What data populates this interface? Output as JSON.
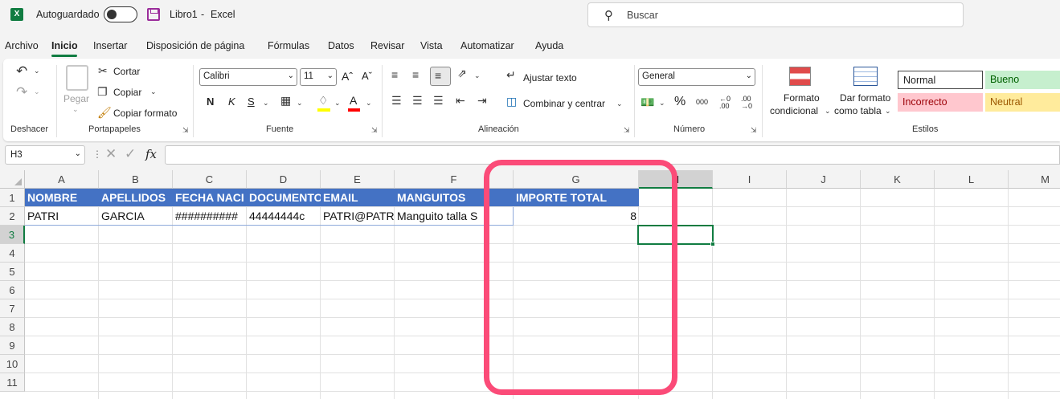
{
  "titlebar": {
    "autosave_label": "Autoguardado",
    "document_title": "Libro1",
    "title_separator": "-",
    "app_name": "Excel",
    "search_placeholder": "Buscar",
    "logo_letter": "X"
  },
  "menu": {
    "tabs": [
      "Archivo",
      "Inicio",
      "Insertar",
      "Disposición de página",
      "Fórmulas",
      "Datos",
      "Revisar",
      "Vista",
      "Automatizar",
      "Ayuda"
    ],
    "active_tab": "Inicio"
  },
  "ribbon": {
    "undo": {
      "group_label": "Deshacer"
    },
    "clipboard": {
      "group_label": "Portapapeles",
      "paste_label": "Pegar",
      "cut_label": "Cortar",
      "copy_label": "Copiar",
      "format_painter_label": "Copiar formato"
    },
    "font": {
      "group_label": "Fuente",
      "font_name": "Calibri",
      "font_size": "11",
      "bold": "N",
      "italic": "K",
      "underline": "S"
    },
    "alignment": {
      "group_label": "Alineación",
      "wrap_text": "Ajustar texto",
      "merge_center": "Combinar y centrar"
    },
    "number": {
      "group_label": "Número",
      "format": "General"
    },
    "styles": {
      "group_label": "Estilos",
      "conditional_format_line1": "Formato",
      "conditional_format_line2": "condicional",
      "format_table_line1": "Dar formato",
      "format_table_line2": "como tabla",
      "cells": [
        {
          "label": "Normal",
          "bg": "#ffffff",
          "fg": "#111111"
        },
        {
          "label": "Bueno",
          "bg": "#c6efce",
          "fg": "#006100"
        },
        {
          "label": "Incorrecto",
          "bg": "#ffc7ce",
          "fg": "#9c0006"
        },
        {
          "label": "Neutral",
          "bg": "#ffeb9c",
          "fg": "#9c5700"
        }
      ]
    }
  },
  "formula_bar": {
    "name_box": "H3",
    "fx_label": "fx",
    "content": ""
  },
  "sheet": {
    "columns": [
      "A",
      "B",
      "C",
      "D",
      "E",
      "F",
      "G",
      "H",
      "I",
      "J",
      "K",
      "L",
      "M"
    ],
    "rows": [
      "1",
      "2",
      "3",
      "4",
      "5",
      "6",
      "7",
      "8",
      "9",
      "10",
      "11"
    ],
    "header_row": [
      "NOMBRE",
      "APELLIDOS",
      "FECHA NACI",
      "DOCUMENTO",
      "EMAIL",
      "MANGUITOS",
      "IMPORTE TOTAL"
    ],
    "data_row": [
      "PATRI",
      "GARCIA",
      "##########",
      "44444444c",
      "PATRI@PATR",
      "Manguito talla S",
      "8"
    ],
    "selected_cell": "H3",
    "header_fill": "#4472c4",
    "accent": "#107c41",
    "highlight_color": "#fb4b78"
  }
}
